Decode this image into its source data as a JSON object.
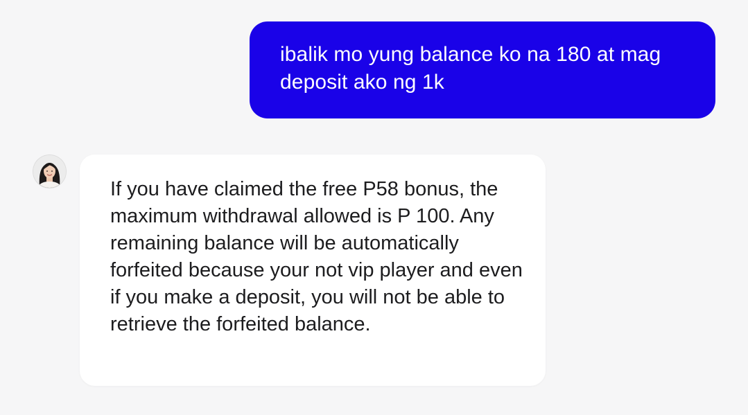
{
  "conversation": {
    "user_message": {
      "text": "ibalik mo yung balance ko na 180 at mag deposit ako ng 1k",
      "bubble_color": "#1a02e8"
    },
    "agent_message": {
      "avatar_icon": "agent-avatar-photo",
      "text": "If you have claimed the free P58 bonus, the maximum withdrawal allowed is P 100. Any remaining balance will be automatically forfeited because your not vip player and even if you make a deposit, you will not be able to retrieve the forfeited balance.",
      "bubble_color": "#ffffff"
    }
  }
}
